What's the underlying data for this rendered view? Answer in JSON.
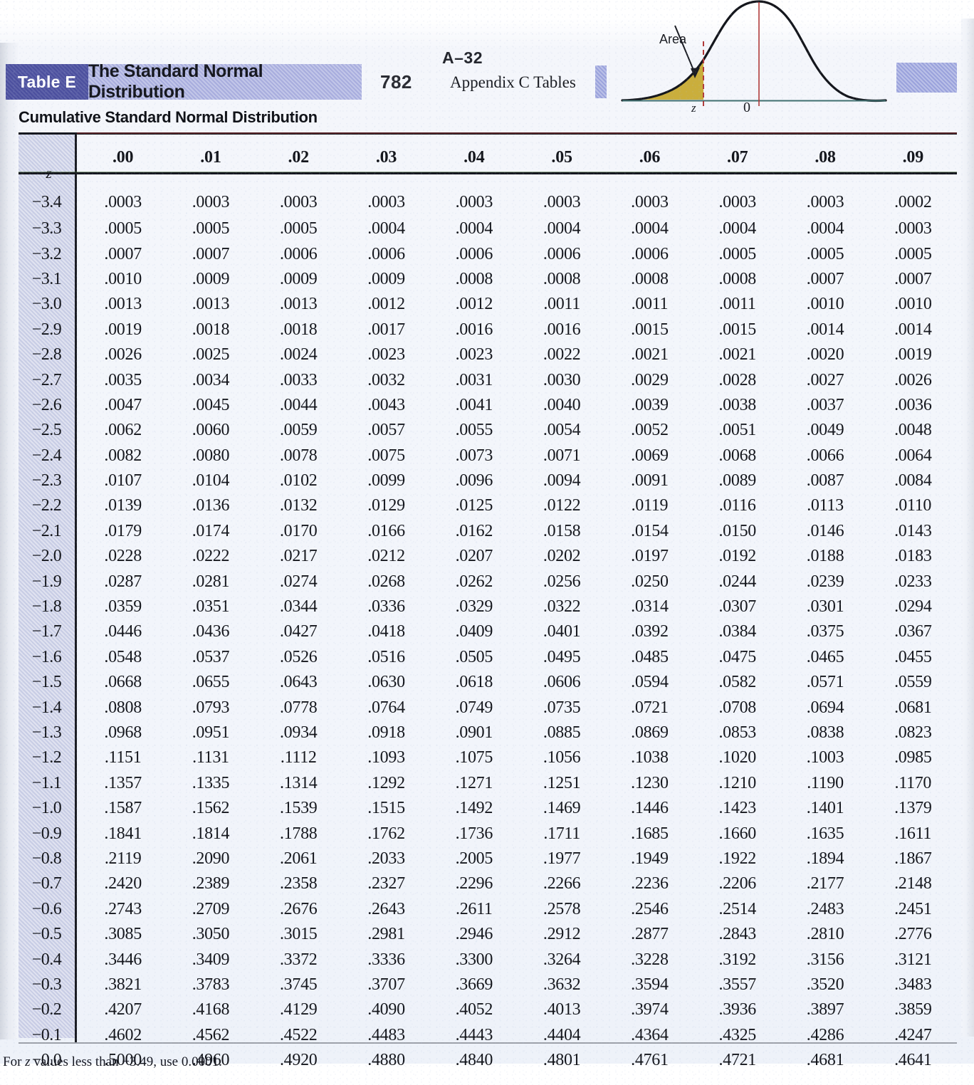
{
  "header": {
    "badge_label": "Table E",
    "title": "The Standard Normal Distribution",
    "page_number": "782",
    "folio_top": "A–32",
    "folio_sub": "Appendix C  Tables"
  },
  "figure": {
    "name": "standard-normal-curve",
    "area_label": "Area",
    "z_tick_label": "z",
    "zero_tick_label": "0",
    "shade_color": "#c5a72b",
    "curve_color": "#14161c",
    "marker_color": "#b03a3a"
  },
  "section": {
    "heading": "Cumulative Standard Normal Distribution"
  },
  "table": {
    "z_header": "z",
    "columns": [
      ".00",
      ".01",
      ".02",
      ".03",
      ".04",
      ".05",
      ".06",
      ".07",
      ".08",
      ".09"
    ],
    "rows": [
      {
        "z": "−3.4",
        "values": [
          ".0003",
          ".0003",
          ".0003",
          ".0003",
          ".0003",
          ".0003",
          ".0003",
          ".0003",
          ".0003",
          ".0002"
        ]
      },
      {
        "z": "−3.3",
        "values": [
          ".0005",
          ".0005",
          ".0005",
          ".0004",
          ".0004",
          ".0004",
          ".0004",
          ".0004",
          ".0004",
          ".0003"
        ]
      },
      {
        "z": "−3.2",
        "values": [
          ".0007",
          ".0007",
          ".0006",
          ".0006",
          ".0006",
          ".0006",
          ".0006",
          ".0005",
          ".0005",
          ".0005"
        ]
      },
      {
        "z": "−3.1",
        "values": [
          ".0010",
          ".0009",
          ".0009",
          ".0009",
          ".0008",
          ".0008",
          ".0008",
          ".0008",
          ".0007",
          ".0007"
        ]
      },
      {
        "z": "−3.0",
        "values": [
          ".0013",
          ".0013",
          ".0013",
          ".0012",
          ".0012",
          ".0011",
          ".0011",
          ".0011",
          ".0010",
          ".0010"
        ]
      },
      {
        "z": "−2.9",
        "values": [
          ".0019",
          ".0018",
          ".0018",
          ".0017",
          ".0016",
          ".0016",
          ".0015",
          ".0015",
          ".0014",
          ".0014"
        ]
      },
      {
        "z": "−2.8",
        "values": [
          ".0026",
          ".0025",
          ".0024",
          ".0023",
          ".0023",
          ".0022",
          ".0021",
          ".0021",
          ".0020",
          ".0019"
        ]
      },
      {
        "z": "−2.7",
        "values": [
          ".0035",
          ".0034",
          ".0033",
          ".0032",
          ".0031",
          ".0030",
          ".0029",
          ".0028",
          ".0027",
          ".0026"
        ]
      },
      {
        "z": "−2.6",
        "values": [
          ".0047",
          ".0045",
          ".0044",
          ".0043",
          ".0041",
          ".0040",
          ".0039",
          ".0038",
          ".0037",
          ".0036"
        ]
      },
      {
        "z": "−2.5",
        "values": [
          ".0062",
          ".0060",
          ".0059",
          ".0057",
          ".0055",
          ".0054",
          ".0052",
          ".0051",
          ".0049",
          ".0048"
        ]
      },
      {
        "z": "−2.4",
        "values": [
          ".0082",
          ".0080",
          ".0078",
          ".0075",
          ".0073",
          ".0071",
          ".0069",
          ".0068",
          ".0066",
          ".0064"
        ]
      },
      {
        "z": "−2.3",
        "values": [
          ".0107",
          ".0104",
          ".0102",
          ".0099",
          ".0096",
          ".0094",
          ".0091",
          ".0089",
          ".0087",
          ".0084"
        ]
      },
      {
        "z": "−2.2",
        "values": [
          ".0139",
          ".0136",
          ".0132",
          ".0129",
          ".0125",
          ".0122",
          ".0119",
          ".0116",
          ".0113",
          ".0110"
        ]
      },
      {
        "z": "−2.1",
        "values": [
          ".0179",
          ".0174",
          ".0170",
          ".0166",
          ".0162",
          ".0158",
          ".0154",
          ".0150",
          ".0146",
          ".0143"
        ]
      },
      {
        "z": "−2.0",
        "values": [
          ".0228",
          ".0222",
          ".0217",
          ".0212",
          ".0207",
          ".0202",
          ".0197",
          ".0192",
          ".0188",
          ".0183"
        ]
      },
      {
        "z": "−1.9",
        "values": [
          ".0287",
          ".0281",
          ".0274",
          ".0268",
          ".0262",
          ".0256",
          ".0250",
          ".0244",
          ".0239",
          ".0233"
        ]
      },
      {
        "z": "−1.8",
        "values": [
          ".0359",
          ".0351",
          ".0344",
          ".0336",
          ".0329",
          ".0322",
          ".0314",
          ".0307",
          ".0301",
          ".0294"
        ]
      },
      {
        "z": "−1.7",
        "values": [
          ".0446",
          ".0436",
          ".0427",
          ".0418",
          ".0409",
          ".0401",
          ".0392",
          ".0384",
          ".0375",
          ".0367"
        ]
      },
      {
        "z": "−1.6",
        "values": [
          ".0548",
          ".0537",
          ".0526",
          ".0516",
          ".0505",
          ".0495",
          ".0485",
          ".0475",
          ".0465",
          ".0455"
        ]
      },
      {
        "z": "−1.5",
        "values": [
          ".0668",
          ".0655",
          ".0643",
          ".0630",
          ".0618",
          ".0606",
          ".0594",
          ".0582",
          ".0571",
          ".0559"
        ]
      },
      {
        "z": "−1.4",
        "values": [
          ".0808",
          ".0793",
          ".0778",
          ".0764",
          ".0749",
          ".0735",
          ".0721",
          ".0708",
          ".0694",
          ".0681"
        ]
      },
      {
        "z": "−1.3",
        "values": [
          ".0968",
          ".0951",
          ".0934",
          ".0918",
          ".0901",
          ".0885",
          ".0869",
          ".0853",
          ".0838",
          ".0823"
        ]
      },
      {
        "z": "−1.2",
        "values": [
          ".1151",
          ".1131",
          ".1112",
          ".1093",
          ".1075",
          ".1056",
          ".1038",
          ".1020",
          ".1003",
          ".0985"
        ]
      },
      {
        "z": "−1.1",
        "values": [
          ".1357",
          ".1335",
          ".1314",
          ".1292",
          ".1271",
          ".1251",
          ".1230",
          ".1210",
          ".1190",
          ".1170"
        ]
      },
      {
        "z": "−1.0",
        "values": [
          ".1587",
          ".1562",
          ".1539",
          ".1515",
          ".1492",
          ".1469",
          ".1446",
          ".1423",
          ".1401",
          ".1379"
        ]
      },
      {
        "z": "−0.9",
        "values": [
          ".1841",
          ".1814",
          ".1788",
          ".1762",
          ".1736",
          ".1711",
          ".1685",
          ".1660",
          ".1635",
          ".1611"
        ]
      },
      {
        "z": "−0.8",
        "values": [
          ".2119",
          ".2090",
          ".2061",
          ".2033",
          ".2005",
          ".1977",
          ".1949",
          ".1922",
          ".1894",
          ".1867"
        ]
      },
      {
        "z": "−0.7",
        "values": [
          ".2420",
          ".2389",
          ".2358",
          ".2327",
          ".2296",
          ".2266",
          ".2236",
          ".2206",
          ".2177",
          ".2148"
        ]
      },
      {
        "z": "−0.6",
        "values": [
          ".2743",
          ".2709",
          ".2676",
          ".2643",
          ".2611",
          ".2578",
          ".2546",
          ".2514",
          ".2483",
          ".2451"
        ]
      },
      {
        "z": "−0.5",
        "values": [
          ".3085",
          ".3050",
          ".3015",
          ".2981",
          ".2946",
          ".2912",
          ".2877",
          ".2843",
          ".2810",
          ".2776"
        ]
      },
      {
        "z": "−0.4",
        "values": [
          ".3446",
          ".3409",
          ".3372",
          ".3336",
          ".3300",
          ".3264",
          ".3228",
          ".3192",
          ".3156",
          ".3121"
        ]
      },
      {
        "z": "−0.3",
        "values": [
          ".3821",
          ".3783",
          ".3745",
          ".3707",
          ".3669",
          ".3632",
          ".3594",
          ".3557",
          ".3520",
          ".3483"
        ]
      },
      {
        "z": "−0.2",
        "values": [
          ".4207",
          ".4168",
          ".4129",
          ".4090",
          ".4052",
          ".4013",
          ".3974",
          ".3936",
          ".3897",
          ".3859"
        ]
      },
      {
        "z": "−0.1",
        "values": [
          ".4602",
          ".4562",
          ".4522",
          ".4483",
          ".4443",
          ".4404",
          ".4364",
          ".4325",
          ".4286",
          ".4247"
        ]
      },
      {
        "z": "−0.0",
        "values": [
          ".5000",
          ".4960",
          ".4920",
          ".4880",
          ".4840",
          ".4801",
          ".4761",
          ".4721",
          ".4681",
          ".4641"
        ]
      }
    ]
  },
  "footnote": {
    "prefix": "For ",
    "italic_z": "z",
    "suffix": " values less than −3.49, use 0.0001."
  },
  "colors": {
    "badge_bg": "#4b4f9e",
    "banner_bg": "#a8adde",
    "zband_bg": "#c6cbe4",
    "rule": "#16181f",
    "paper": "#f2f5fb"
  }
}
